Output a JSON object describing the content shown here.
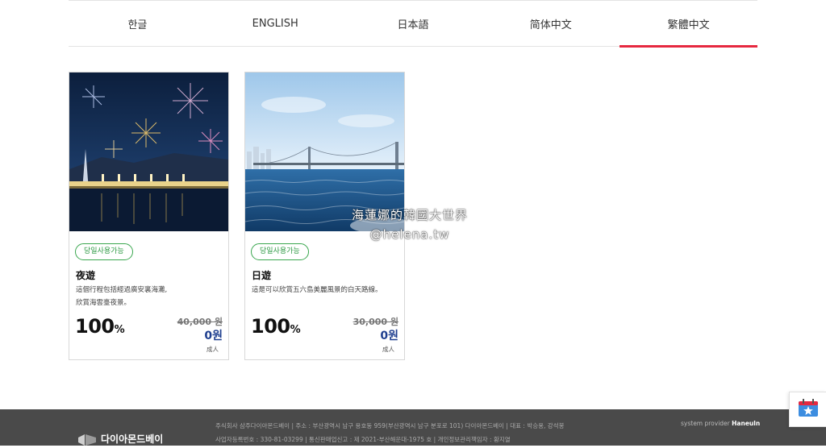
{
  "languages": [
    {
      "label": "한글"
    },
    {
      "label": "ENGLISH"
    },
    {
      "label": "日本語"
    },
    {
      "label": "简体中文"
    },
    {
      "label": "繁體中文",
      "active": true
    }
  ],
  "products": [
    {
      "badge": "당일사용가능",
      "title": "夜遊",
      "desc_line1": "這個行程包括經過廣安裏海灘,",
      "desc_line2": "欣賞海雲臺夜景。",
      "discount_value": "100",
      "discount_unit": "%",
      "original_price": "40,000 원",
      "sale_price": "0원",
      "age": "成人",
      "photo": "night-fireworks-bridge"
    },
    {
      "badge": "당일사용가능",
      "title": "日遊",
      "desc_line1": "這是可以欣賞五六島美麗風景的白天路線。",
      "desc_line2": "",
      "discount_value": "100",
      "discount_unit": "%",
      "original_price": "30,000 원",
      "sale_price": "0원",
      "age": "成人",
      "photo": "day-sea-bridge"
    }
  ],
  "watermark": {
    "line1": "海蓮娜的韓國大世界",
    "line2": "@helena.tw"
  },
  "footer": {
    "logo_text": "다이아몬드베이",
    "info_line1": "주식회사 삼주다이아몬드베이  |  주소 : 부산광역시 남구 용호동 959(부산광역시 남구 분포로 101) 다이아몬드베이  |  대표 : 박승용, 강석봉",
    "info_line2": "사업자등록번호 : 330-81-03299  |  통신판매업신고 : 제 2021-부산해운대-1975 호  |  개인정보관리책임자 : 황지열",
    "provider_prefix": "system provider",
    "provider_name": "Haneuln"
  },
  "colors": {
    "accent": "#e6283f",
    "badge": "#3aa74f",
    "price": "#1f3f8f",
    "footer": "#4a4a4a"
  },
  "icons": {
    "floating": "calendar-star-icon"
  }
}
